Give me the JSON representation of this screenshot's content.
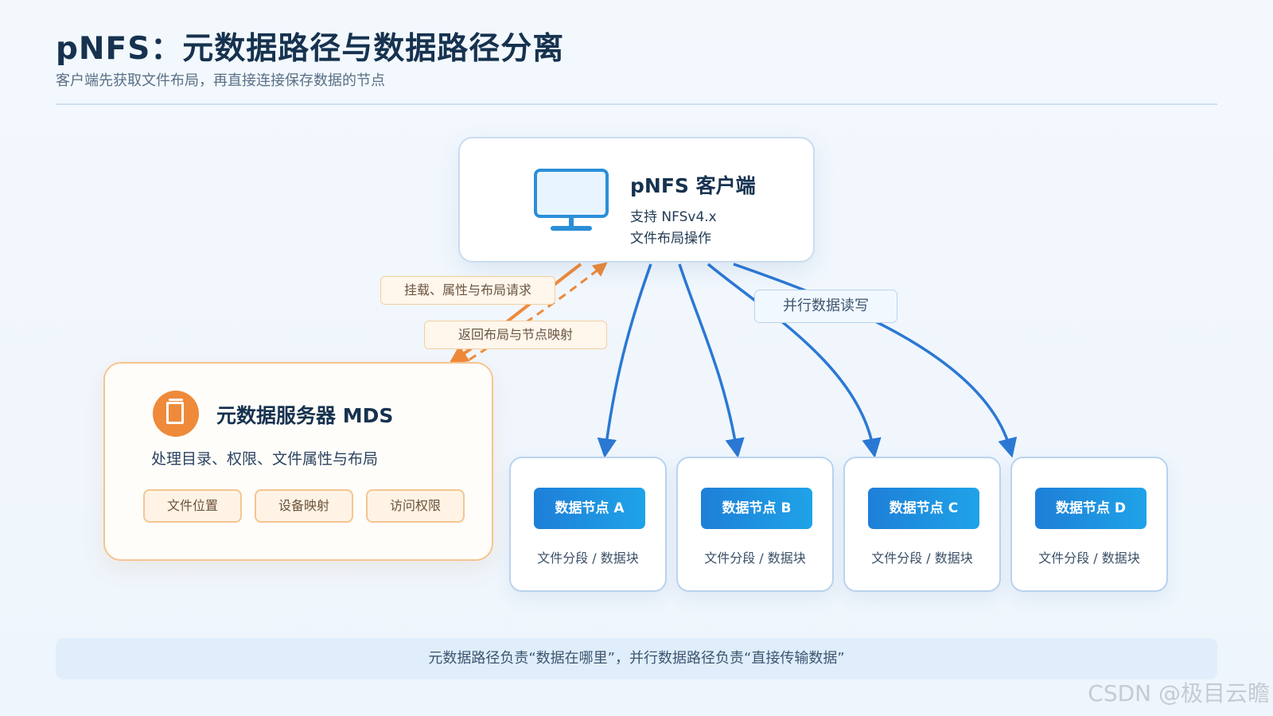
{
  "header": {
    "title": "pNFS：元数据路径与数据路径分离",
    "subtitle": "客户端先获取文件布局，再直接连接保存数据的节点"
  },
  "client": {
    "icon": "monitor-icon",
    "name": "pNFS 客户端",
    "line1": "支持 NFSv4.x",
    "line2": "文件布局操作"
  },
  "mds": {
    "icon": "document-icon",
    "name": "元数据服务器 MDS",
    "description": "处理目录、权限、文件属性与布局",
    "chips": [
      "文件位置",
      "设备映射",
      "访问权限"
    ]
  },
  "links": {
    "request_label": "挂载、属性与布局请求",
    "response_label": "返回布局与节点映射",
    "data_label": "并行数据读写"
  },
  "nodes": [
    {
      "title": "数据节点 A",
      "subtitle": "文件分段 / 数据块"
    },
    {
      "title": "数据节点 B",
      "subtitle": "文件分段 / 数据块"
    },
    {
      "title": "数据节点 C",
      "subtitle": "文件分段 / 数据块"
    },
    {
      "title": "数据节点 D",
      "subtitle": "文件分段 / 数据块"
    }
  ],
  "footer": {
    "note": "元数据路径负责“数据在哪里”，并行数据路径负责“直接传输数据”"
  },
  "watermark": "CSDN @极目云瞻",
  "colors": {
    "accent_blue": "#2b78d4",
    "accent_orange": "#ee8a3a",
    "title": "#16324f"
  }
}
